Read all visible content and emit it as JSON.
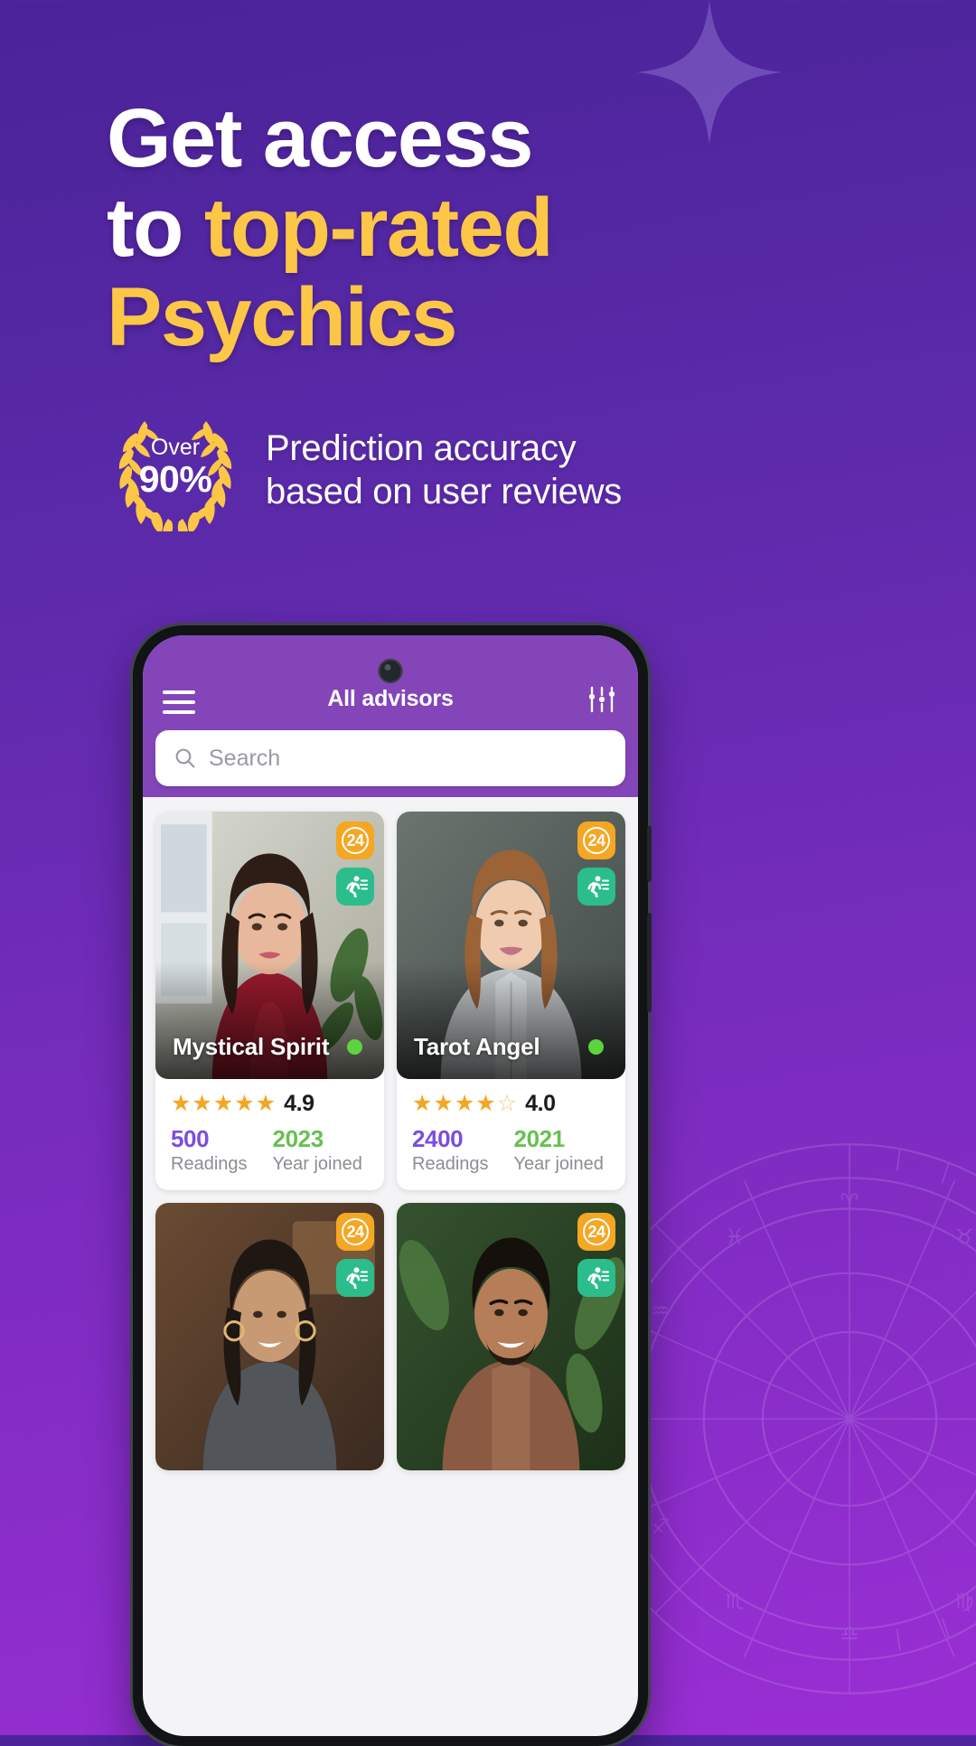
{
  "hero": {
    "headline_line1": "Get access",
    "headline_line2_plain": "to ",
    "headline_line2_accent": "top-rated",
    "headline_line3_accent": "Psychics",
    "badge_over": "Over",
    "badge_percent": "90%",
    "subtitle_line1": "Prediction accuracy",
    "subtitle_line2": "based on user reviews",
    "accent_color": "#FCC646",
    "background_start": "#4A2399",
    "background_end": "#9A2ED4"
  },
  "app": {
    "appbar": {
      "menu_icon": "hamburger-menu-icon",
      "title": "All advisors",
      "filter_icon": "sliders-filter-icon"
    },
    "search": {
      "icon": "search-icon",
      "placeholder": "Search",
      "value": ""
    },
    "cards": [
      {
        "name": "Mystical Spirit",
        "rating": "4.9",
        "stars_filled": 5,
        "stars_total": 5,
        "readings_value": "500",
        "readings_label": "Readings",
        "joined_value": "2023",
        "joined_label": "Year joined",
        "badge_hours": "24",
        "badge_fast_icon": "fast-response-runner-icon",
        "online": true,
        "photo": "woman-in-red-top-smiling"
      },
      {
        "name": "Tarot Angel",
        "rating": "4.0",
        "stars_filled": 4,
        "stars_total": 5,
        "readings_value": "2400",
        "readings_label": "Readings",
        "joined_value": "2021",
        "joined_label": "Year joined",
        "badge_hours": "24",
        "badge_fast_icon": "fast-response-runner-icon",
        "online": true,
        "photo": "woman-in-grey-shirt-smiling"
      },
      {
        "name": "",
        "rating": "",
        "stars_filled": 0,
        "stars_total": 5,
        "readings_value": "",
        "readings_label": "",
        "joined_value": "",
        "joined_label": "",
        "badge_hours": "24",
        "badge_fast_icon": "fast-response-runner-icon",
        "online": false,
        "photo": "woman-with-hoop-earrings"
      },
      {
        "name": "",
        "rating": "",
        "stars_filled": 0,
        "stars_total": 5,
        "readings_value": "",
        "readings_label": "",
        "joined_value": "",
        "joined_label": "",
        "badge_hours": "24",
        "badge_fast_icon": "fast-response-runner-icon",
        "online": false,
        "photo": "man-in-brown-shirt-smiling"
      }
    ]
  }
}
